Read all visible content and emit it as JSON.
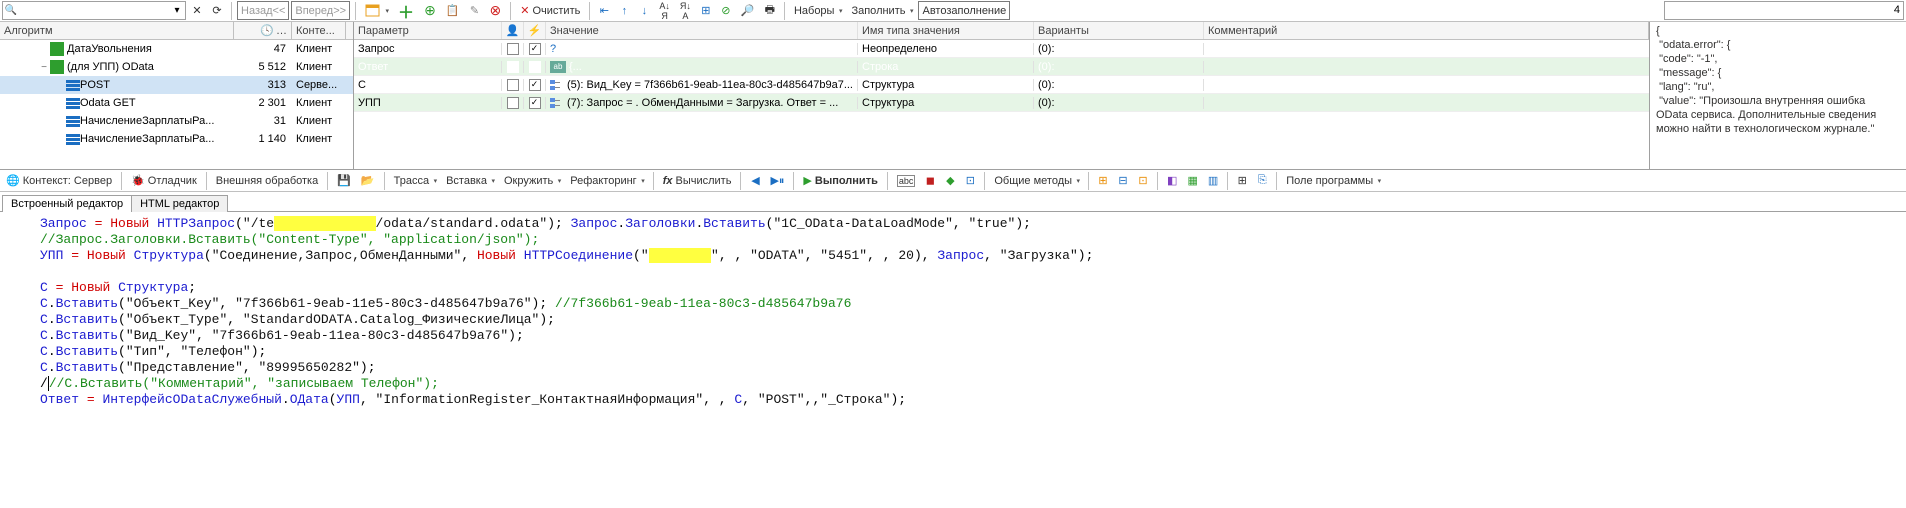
{
  "topbar": {
    "search_prefix_text": "",
    "history_back": "Назад<<",
    "history_fwd": "Вперед>>",
    "dropdown_open": "▾",
    "btn_clear": "Очистить",
    "btn_nabory": "Наборы",
    "btn_fill": "Заполнить",
    "btn_autofill": "Автозаполнение",
    "num_value": "4"
  },
  "tree": {
    "headers": {
      "algo": "Алгоритм",
      "time": "…",
      "context": "Конте..."
    },
    "time_icon_title": "Время",
    "rows": [
      {
        "indent": 1,
        "toggle": "",
        "icon": "ic-green",
        "label": "ДатаУвольнения",
        "num": "47",
        "ctx": "Клиент",
        "sel": false
      },
      {
        "indent": 1,
        "toggle": "−",
        "icon": "ic-green",
        "label": "(для УПП) OData",
        "num": "5 512",
        "ctx": "Клиент",
        "sel": false
      },
      {
        "indent": 2,
        "toggle": "",
        "icon": "bar",
        "label": "POST",
        "num": "313",
        "ctx": "Серве...",
        "sel": true
      },
      {
        "indent": 2,
        "toggle": "",
        "icon": "bar",
        "label": "Odata GET",
        "num": "2 301",
        "ctx": "Клиент",
        "sel": false
      },
      {
        "indent": 2,
        "toggle": "",
        "icon": "bar",
        "label": "НачислениеЗарплатыРа...",
        "num": "31",
        "ctx": "Клиент",
        "sel": false
      },
      {
        "indent": 2,
        "toggle": "",
        "icon": "bar",
        "label": "НачислениеЗарплатыРа...",
        "num": "1 140",
        "ctx": "Клиент",
        "sel": false
      }
    ]
  },
  "params": {
    "headers": {
      "param": "Параметр",
      "value": "Значение",
      "type": "Имя типа значения",
      "options": "Варианты",
      "comment": "Комментарий"
    },
    "rows": [
      {
        "name": "Запрос",
        "cb1": false,
        "cb2": true,
        "val_icon": "q",
        "val": "",
        "type": "Неопределено",
        "opt": "(0):",
        "row_class": "",
        "sel": false
      },
      {
        "name": "Ответ",
        "cb1": false,
        "cb2": true,
        "val_icon": "abc",
        "val": "{...",
        "type": "Строка",
        "opt": "(0):",
        "row_class": "green",
        "sel": true
      },
      {
        "name": "С",
        "cb1": false,
        "cb2": true,
        "val_icon": "struct",
        "val": "(5): Вид_Key = 7f366b61-9eab-11ea-80c3-d485647b9a7...",
        "type": "Структура",
        "opt": "(0):",
        "row_class": "",
        "sel": false
      },
      {
        "name": "УПП",
        "cb1": false,
        "cb2": true,
        "val_icon": "struct",
        "val": "(7): Запрос = . ОбменДанными = Загрузка. Ответ = ...",
        "type": "Структура",
        "opt": "(0):",
        "row_class": "green",
        "sel": false
      }
    ]
  },
  "error_pane": "{\n \"odata.error\": {\n \"code\": \"-1\",\n \"message\": {\n \"lang\": \"ru\",\n \"value\": \"Произошла внутренняя ошибка OData сервиса. Дополнительные сведения можно найти в технологическом журнале.\"\n",
  "midbar": {
    "context": "Контекст: Сервер",
    "debugger": "Отладчик",
    "external": "Внешняя обработка",
    "trace": "Трасса",
    "insert": "Вставка",
    "surround": "Окружить",
    "refactor": "Рефакторинг",
    "fx": "fx",
    "compute": "Вычислить",
    "run": "Выполнить",
    "commons": "Общие методы",
    "field": "Поле программы"
  },
  "tabs": {
    "builtin": "Встроенный редактор",
    "html": "HTML редактор"
  },
  "code_tokens": {
    "l1a": "Запрос",
    "l1b": "Новый",
    "l1c": "HTTPЗапрос",
    "l1d": "\"/te",
    "l1e": "/odata/standard.odata\"",
    "l1f": "Запрос",
    "l1g": "Заголовки",
    "l1h": "Вставить",
    "l1i": "\"1C_OData-DataLoadMode\"",
    "l1j": "\"true\"",
    "l2": "//Запрос.Заголовки.Вставить(\"Content-Type\", \"application/json\");",
    "l3a": "УПП",
    "l3b": "Новый",
    "l3c": "Структура",
    "l3d": "\"Соединение,Запрос,ОбменДанными\"",
    "l3e": "Новый",
    "l3f": "HTTPСоединение",
    "l3g": "\"",
    "l3h": "\"",
    "l3i": "\"ODATA\"",
    "l3j": "\"5451\"",
    "l3k": "20",
    "l3l": "Запрос",
    "l3m": "\"Загрузка\"",
    "l5a": "С",
    "l5b": "Новый",
    "l5c": "Структура",
    "l6a": "С",
    "l6b": "Вставить",
    "l6c": "\"Объект_Key\"",
    "l6d": "\"7f366b61-9eab-11e5-80c3-d485647b9a76\"",
    "l6e": "//7f366b61-9eab-11ea-80c3-d485647b9a76",
    "l7a": "С",
    "l7b": "Вставить",
    "l7c": "\"Объект_Type\"",
    "l7d": "\"StandardODATA.Catalog_ФизическиеЛица\"",
    "l8a": "С",
    "l8b": "Вставить",
    "l8c": "\"Вид_Key\"",
    "l8d": "\"7f366b61-9eab-11ea-80c3-d485647b9a76\"",
    "l9a": "С",
    "l9b": "Вставить",
    "l9c": "\"Тип\"",
    "l9d": "\"Телефон\"",
    "l10a": "С",
    "l10b": "Вставить",
    "l10c": "\"Представление\"",
    "l10d": "\"89995650282\"",
    "l11": "//С.Вставить(\"Комментарий\", \"записываем Телефон\");",
    "l12a": "Ответ",
    "l12b": "ИнтерфейсODataСлужебный",
    "l12c": "ОДата",
    "l12d": "УПП",
    "l12e": "\"InformationRegister_КонтактнаяИнформация\"",
    "l12f": "С",
    "l12g": "\"POST\"",
    "l12h": "\"_Строка\""
  }
}
